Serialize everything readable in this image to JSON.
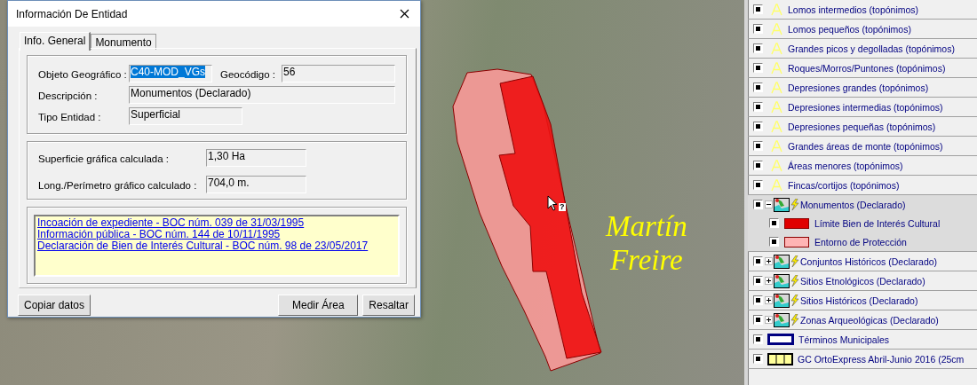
{
  "map": {
    "labels": [
      "Martín",
      "Freire"
    ],
    "cursor_badge": "?"
  },
  "dialog": {
    "title": "Información De Entidad",
    "tabs": [
      {
        "label": "Info. General",
        "selected": true
      },
      {
        "label": "Monumento",
        "selected": false
      }
    ],
    "general_fields": [
      {
        "label": "Objeto Geográfico :",
        "value": "C40-MOD_VGs",
        "text_selected": true
      },
      {
        "label": "Geocódigo :",
        "value": "56",
        "text_selected": false
      },
      {
        "label": "Descripción :",
        "value": "Monumentos (Declarado)",
        "text_selected": false
      },
      {
        "label": "Tipo Entidad :",
        "value": "Superficial",
        "text_selected": false
      }
    ],
    "measurements": [
      {
        "label": "Superficie gráfica calculada :",
        "value": "1,30 Ha"
      },
      {
        "label": "Long./Perímetro gráfico calculado :",
        "value": "704,0 m."
      }
    ],
    "links": [
      "Incoación de expediente - BOC núm. 039 de 31/03/1995",
      "Información pública - BOC núm. 144 de 10/11/1995",
      "Declaración de Bien de Interés Cultural - BOC núm. 98 de 23/05/2017"
    ],
    "buttons": [
      "Copiar datos",
      "Medir Área",
      "Resaltar"
    ]
  },
  "legend": {
    "items": [
      {
        "kind": "label",
        "label": "Lomos intermedios (topónimos)",
        "checked": true,
        "selected": false
      },
      {
        "kind": "label",
        "label": "Lomos pequeños (topónimos)",
        "checked": true,
        "selected": false
      },
      {
        "kind": "label",
        "label": "Grandes picos y degolladas (topónimos)",
        "checked": true,
        "selected": false
      },
      {
        "kind": "label",
        "label": "Roques/Morros/Puntones (topónimos)",
        "checked": true,
        "selected": false
      },
      {
        "kind": "label",
        "label": "Depresiones grandes (topónimos)",
        "checked": true,
        "selected": false
      },
      {
        "kind": "label",
        "label": "Depresiones intermedias (topónimos)",
        "checked": true,
        "selected": false
      },
      {
        "kind": "label",
        "label": "Depresiones pequeñas (topónimos)",
        "checked": true,
        "selected": false
      },
      {
        "kind": "label",
        "label": "Grandes áreas de monte (topónimos)",
        "checked": true,
        "selected": false
      },
      {
        "kind": "label",
        "label": "Áreas menores (topónimos)",
        "checked": true,
        "selected": false
      },
      {
        "kind": "label",
        "label": "Fincas/cortijos (topónimos)",
        "checked": true,
        "selected": false
      },
      {
        "kind": "group",
        "label": "Monumentos (Declarado)",
        "checked": true,
        "expanded": true,
        "selected": true,
        "children": [
          {
            "kind": "swatch",
            "label": "Límite Bien de Interés Cultural",
            "checked": true,
            "color": "#e00000"
          },
          {
            "kind": "swatch",
            "label": "Entorno de Protección",
            "checked": true,
            "color": "#ffb4b4"
          }
        ]
      },
      {
        "kind": "group",
        "label": "Conjuntos Históricos (Declarado)",
        "checked": true,
        "expanded": false,
        "selected": false
      },
      {
        "kind": "group",
        "label": "Sitios Etnológicos (Declarado)",
        "checked": true,
        "expanded": false,
        "selected": false
      },
      {
        "kind": "group",
        "label": "Sitios Históricos (Declarado)",
        "checked": true,
        "expanded": false,
        "selected": false
      },
      {
        "kind": "group",
        "label": "Zonas Arqueológicas (Declarado)",
        "checked": true,
        "expanded": false,
        "selected": false
      },
      {
        "kind": "line",
        "label": "Términos Municipales",
        "checked": true,
        "selected": false
      },
      {
        "kind": "raster",
        "label": "GC OrtoExpress Abril-Junio 2016 (25cm",
        "checked": true,
        "selected": false
      }
    ]
  }
}
